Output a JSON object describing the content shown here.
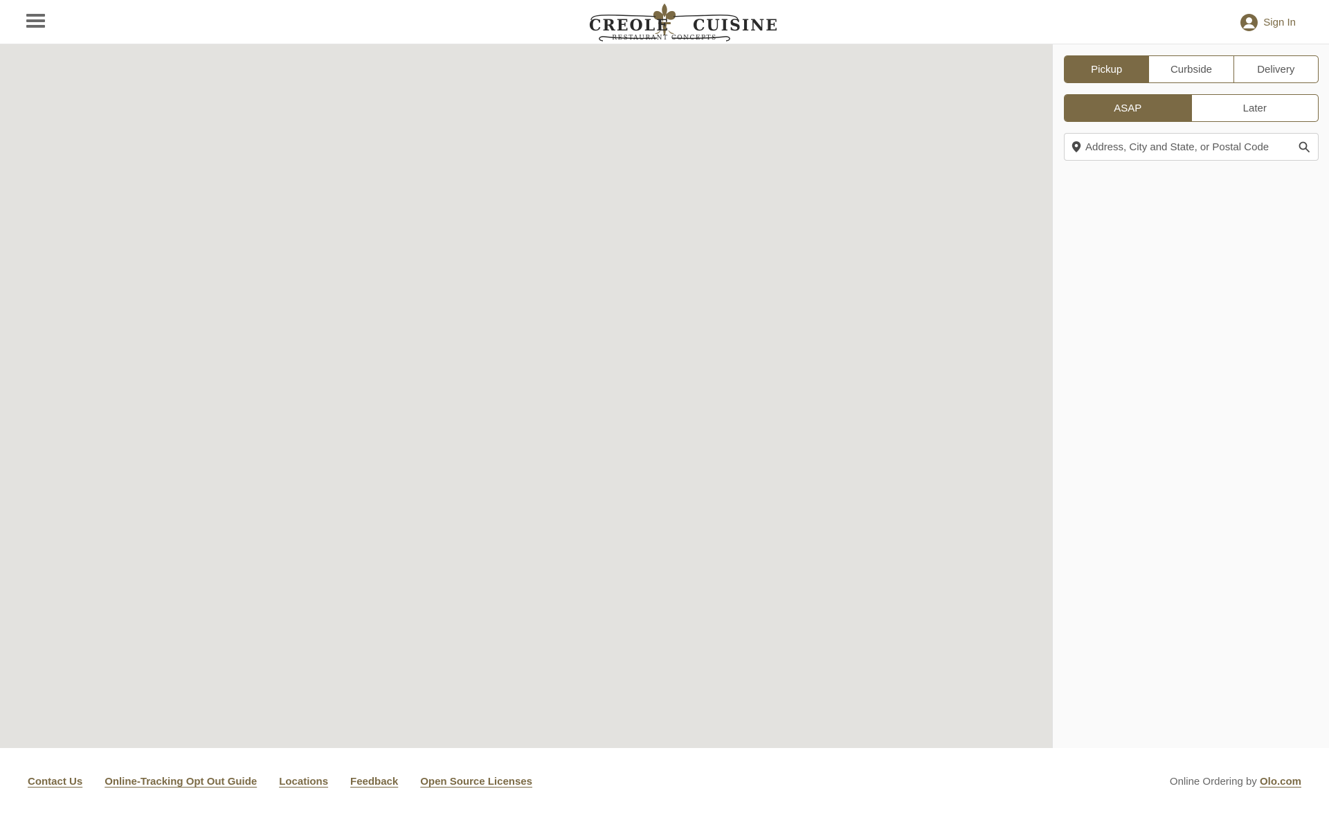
{
  "header": {
    "menu_icon": "hamburger-menu-icon",
    "logo": {
      "main_left": "CREOLE",
      "main_right": "CUISINE",
      "sub": "RESTAURANT CONCEPTS",
      "emblem_icon": "fleur-de-lis-icon"
    },
    "signin": {
      "icon": "user-circle-icon",
      "label": "Sign In"
    }
  },
  "panel": {
    "handoff_modes": [
      {
        "label": "Pickup",
        "selected": true
      },
      {
        "label": "Curbside",
        "selected": false
      },
      {
        "label": "Delivery",
        "selected": false
      }
    ],
    "time_modes": [
      {
        "label": "ASAP",
        "selected": true
      },
      {
        "label": "Later",
        "selected": false
      }
    ],
    "search": {
      "value": "",
      "placeholder": "Address, City and State, or Postal Code",
      "pin_icon": "map-pin-icon",
      "search_icon": "search-icon"
    }
  },
  "footer": {
    "links": [
      "Contact Us",
      "Online-Tracking Opt Out Guide",
      "Locations",
      "Feedback",
      "Open Source Licenses"
    ],
    "powered_prefix": "Online Ordering by",
    "powered_link": "Olo.com"
  },
  "colors": {
    "brand": "#7b6a45",
    "map_background": "#e3e2df",
    "panel_background": "#fafafa"
  }
}
